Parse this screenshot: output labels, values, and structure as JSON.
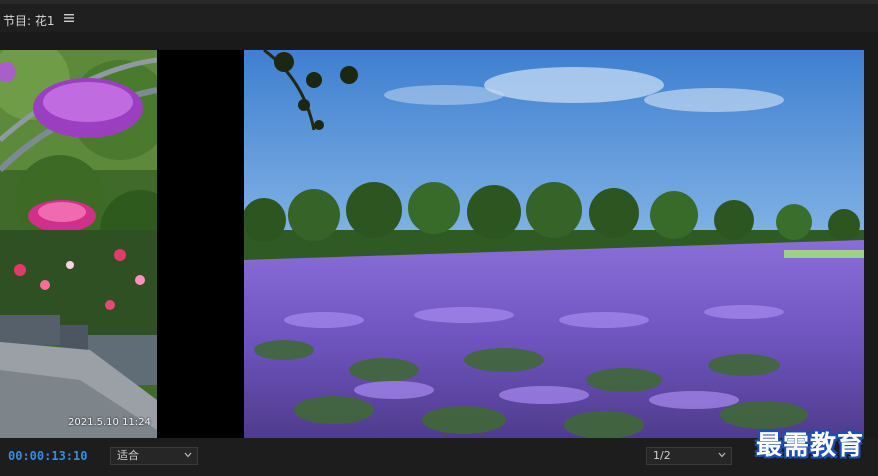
{
  "panel": {
    "title": "节目: 花1",
    "menu_icon": "hamburger-menu-icon"
  },
  "viewer": {
    "left_clip_timestamp": "2021.5.10 11:24"
  },
  "controls": {
    "timecode": "00:00:13:10",
    "fit_select": "适合",
    "resolution_select": "1/2"
  },
  "watermark": {
    "brand": "最需教育"
  },
  "colors": {
    "timecode": "#2f8fe8",
    "brand_outline": "#1c4fb0",
    "panel_bg": "#1d1d1d"
  }
}
